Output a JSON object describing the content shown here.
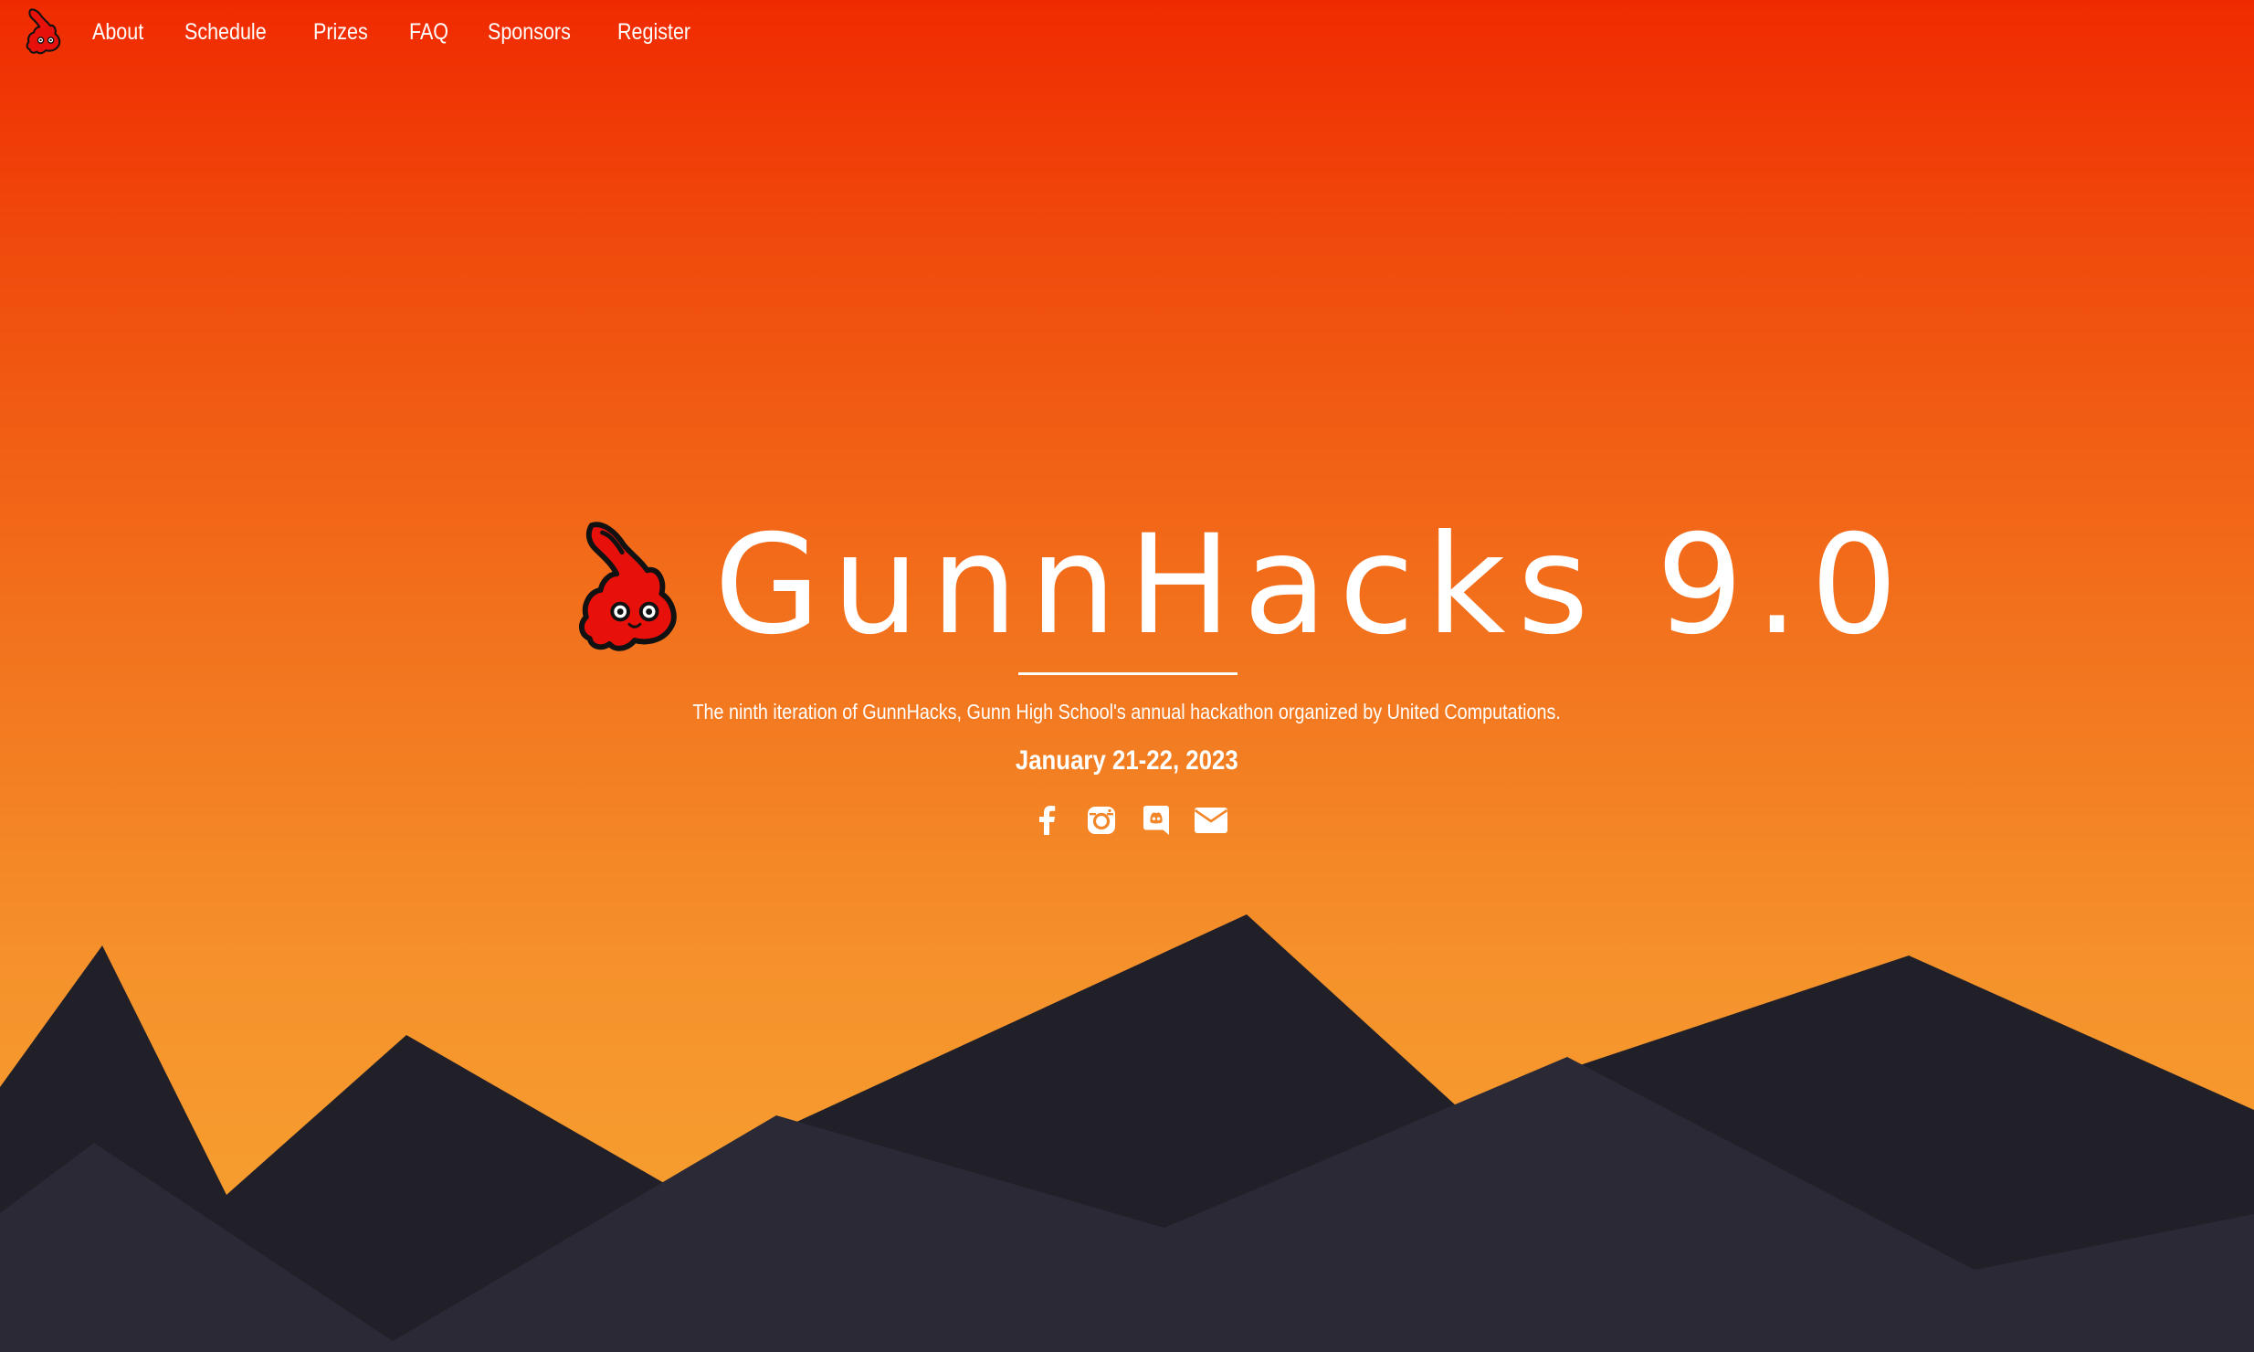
{
  "nav": {
    "logo_icon": "gunnhacks-flame-mascot-icon",
    "links": [
      {
        "label": "About"
      },
      {
        "label": "Schedule"
      },
      {
        "label": "Prizes"
      },
      {
        "label": "FAQ"
      },
      {
        "label": "Sponsors"
      },
      {
        "label": "Register"
      }
    ]
  },
  "hero": {
    "mascot_icon": "gunnhacks-flame-mascot-icon",
    "title": "GunnHacks 9.0",
    "description": "The ninth iteration of GunnHacks, Gunn High School's annual hackathon organized by United Computations.",
    "date": "January 21-22, 2023"
  },
  "social": [
    {
      "icon": "facebook-icon"
    },
    {
      "icon": "instagram-icon"
    },
    {
      "icon": "discord-icon"
    },
    {
      "icon": "email-icon"
    }
  ],
  "colors": {
    "gradient_top": "#f02a00",
    "gradient_bottom": "#f7a432",
    "mountain_back": "#212028",
    "mountain_front": "#2a2935",
    "mascot_red": "#e8100a",
    "text": "#ffffff"
  }
}
